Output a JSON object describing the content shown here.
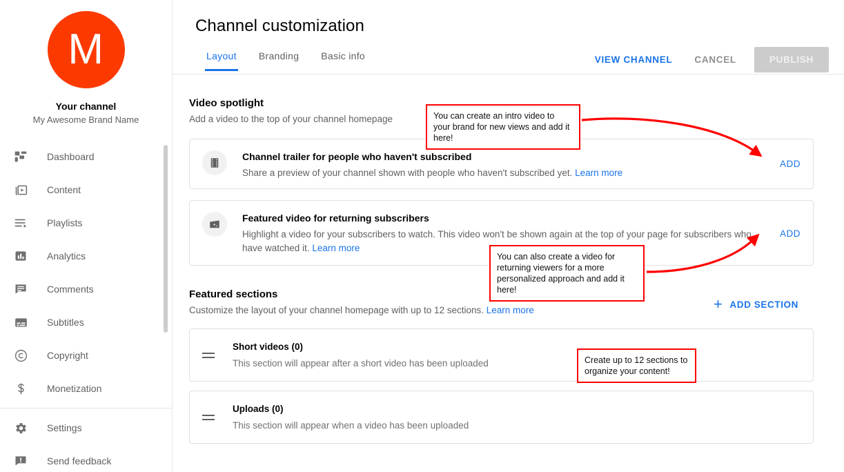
{
  "sidebar": {
    "avatar_letter": "M",
    "avatar_color": "#fc3a00",
    "channel_label": "Your channel",
    "brand_name": "My Awesome Brand Name",
    "items": [
      {
        "label": "Dashboard",
        "icon": "dashboard-icon"
      },
      {
        "label": "Content",
        "icon": "content-icon"
      },
      {
        "label": "Playlists",
        "icon": "playlists-icon"
      },
      {
        "label": "Analytics",
        "icon": "analytics-icon"
      },
      {
        "label": "Comments",
        "icon": "comments-icon"
      },
      {
        "label": "Subtitles",
        "icon": "subtitles-icon"
      },
      {
        "label": "Copyright",
        "icon": "copyright-icon"
      },
      {
        "label": "Monetization",
        "icon": "monetization-icon"
      }
    ],
    "footer_items": [
      {
        "label": "Settings",
        "icon": "gear-icon"
      },
      {
        "label": "Send feedback",
        "icon": "feedback-icon"
      }
    ]
  },
  "header": {
    "title": "Channel customization",
    "tabs": [
      {
        "label": "Layout",
        "active": true
      },
      {
        "label": "Branding",
        "active": false
      },
      {
        "label": "Basic info",
        "active": false
      }
    ],
    "view_channel_label": "VIEW CHANNEL",
    "cancel_label": "CANCEL",
    "publish_label": "PUBLISH",
    "accent_color": "#1a73e8"
  },
  "video_spotlight": {
    "title": "Video spotlight",
    "subtitle": "Add a video to the top of your channel homepage",
    "cards": [
      {
        "icon": "film-strip-icon",
        "title": "Channel trailer for people who haven't subscribed",
        "desc": "Share a preview of your channel shown with people who haven't subscribed yet.",
        "learn_more": "Learn more",
        "action": "ADD"
      },
      {
        "icon": "clapperboard-sparkle-icon",
        "title": "Featured video for returning subscribers",
        "desc": "Highlight a video for your subscribers to watch. This video won't be shown again at the top of your page for subscribers who have watched it.",
        "learn_more": "Learn more",
        "action": "ADD"
      }
    ]
  },
  "featured_sections": {
    "title": "Featured sections",
    "subtitle": "Customize the layout of your channel homepage with up to 12 sections.",
    "learn_more": "Learn more",
    "add_section_label": "ADD SECTION",
    "rows": [
      {
        "title": "Short videos (0)",
        "desc": "This section will appear after a short video has been uploaded"
      },
      {
        "title": "Uploads (0)",
        "desc": "This section will appear when a video has been uploaded"
      }
    ]
  },
  "annotations": {
    "color": "#ff0000",
    "notes": [
      {
        "text": "You can create an intro video to your brand for new views and add it here!"
      },
      {
        "text": "You can also create a video for returning viewers for a more personalized approach and add it here!"
      },
      {
        "text": "Create up to 12 sections to organize your content!"
      }
    ]
  }
}
